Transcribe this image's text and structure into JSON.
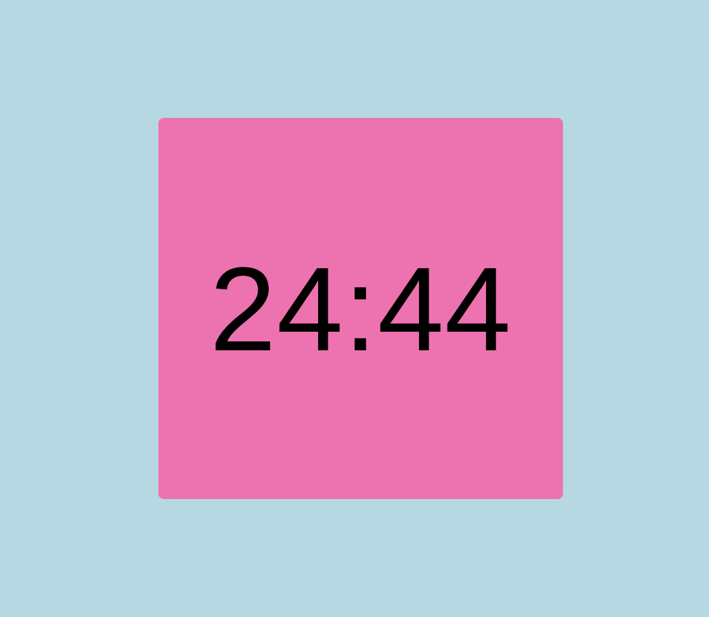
{
  "timer": {
    "display_text": "24:44"
  },
  "colors": {
    "background": "#b5d8e2",
    "card": "#ed72b0",
    "text": "#000000"
  }
}
